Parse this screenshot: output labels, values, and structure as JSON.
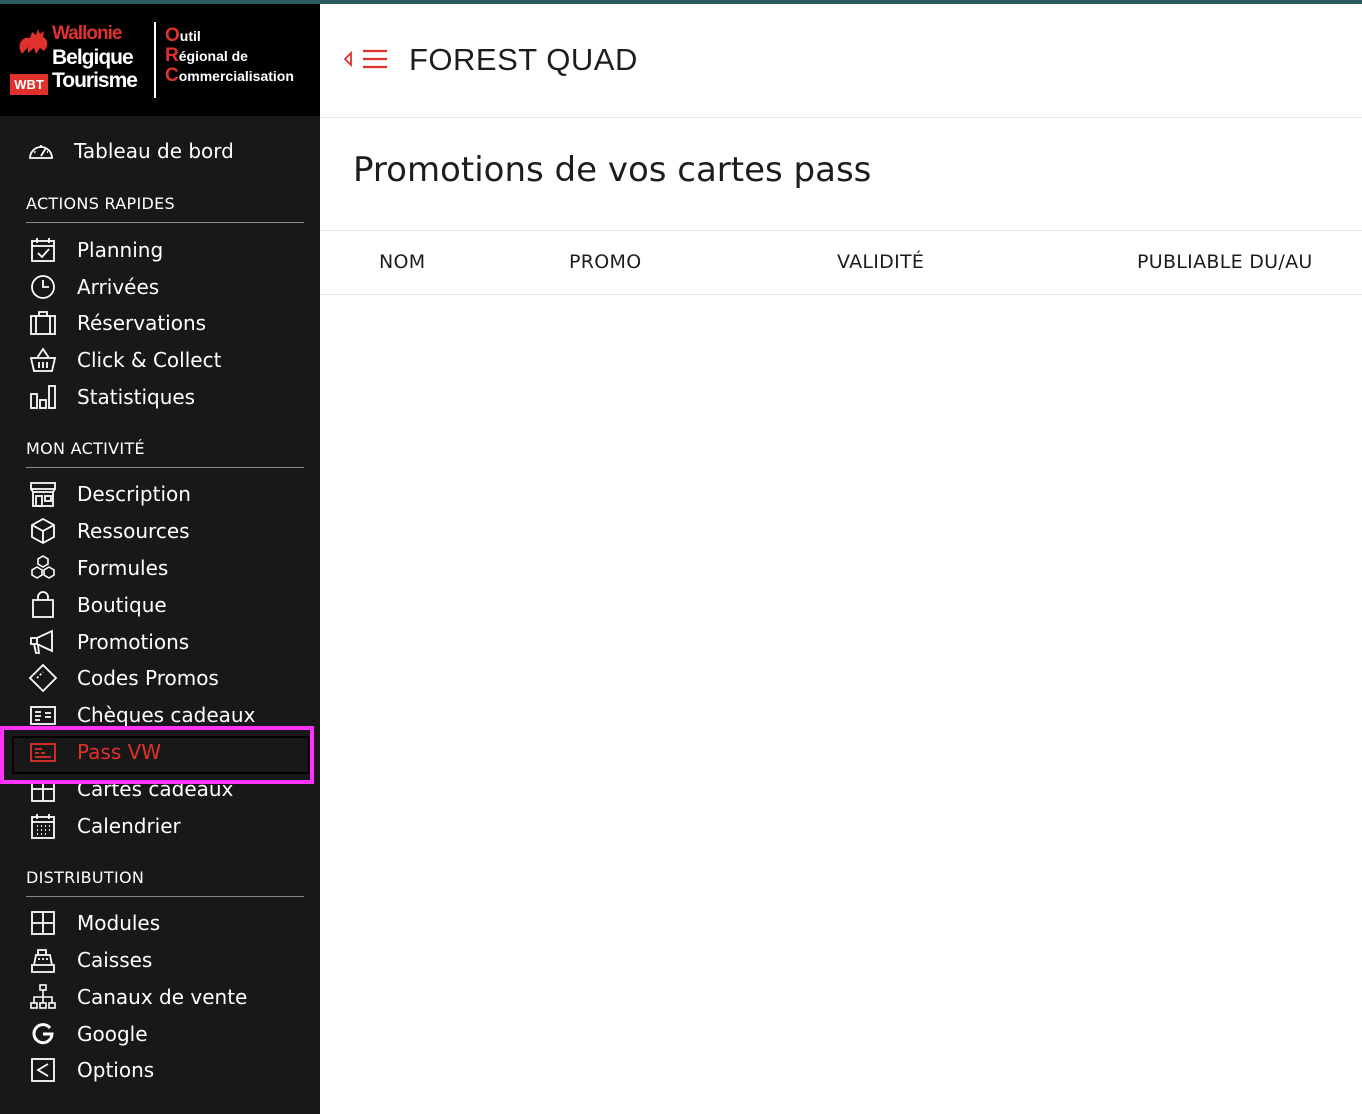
{
  "brand": {
    "wbt_line1": "Wallonie",
    "wbt_line2": "Belgique",
    "wbt_line3": "Tourisme",
    "wbt_badge": "WBT",
    "orc_o": "O",
    "orc_o_rest": "util",
    "orc_r": "R",
    "orc_r_rest": "égional de",
    "orc_c": "C",
    "orc_c_rest": "ommercialisation"
  },
  "sidebar": {
    "dashboard": "Tableau de bord",
    "sections": {
      "quick": "ACTIONS RAPIDES",
      "activity": "MON ACTIVITÉ",
      "distribution": "DISTRIBUTION"
    },
    "quick_items": {
      "planning": "Planning",
      "arrivals": "Arrivées",
      "reservations": "Réservations",
      "click_collect": "Click & Collect",
      "stats": "Statistiques"
    },
    "activity_items": {
      "description": "Description",
      "resources": "Ressources",
      "formulas": "Formules",
      "shop": "Boutique",
      "promotions": "Promotions",
      "promo_codes": "Codes Promos",
      "gift_cheques": "Chèques cadeaux",
      "pass_vw": "Pass VW",
      "gift_cards": "Cartes cadeaux",
      "calendar": "Calendrier"
    },
    "distribution_items": {
      "modules": "Modules",
      "cash": "Caisses",
      "channels": "Canaux de vente",
      "google": "Google",
      "options": "Options"
    }
  },
  "header": {
    "company": "FOREST QUAD"
  },
  "main": {
    "title": "Promotions de vos cartes pass",
    "columns": [
      "NOM",
      "PROMO",
      "VALIDITÉ",
      "PUBLIABLE DU/AU"
    ]
  },
  "colors": {
    "accent": "#e0312d",
    "sidebar_bg": "#181818",
    "highlight": "#ff33ff"
  }
}
